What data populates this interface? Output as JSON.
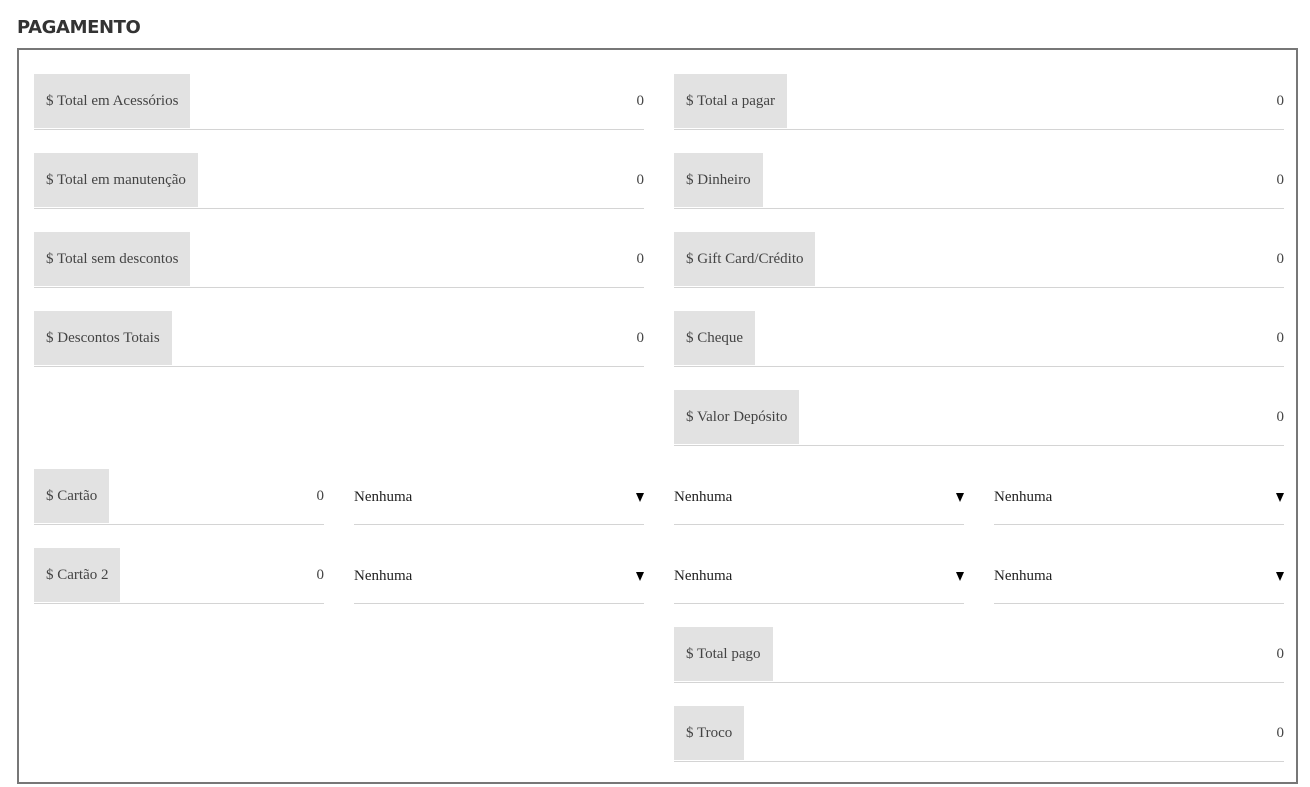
{
  "section": {
    "title": "PAGAMENTO"
  },
  "left_fields": [
    {
      "label": "$ Total em Acessórios",
      "value": "0"
    },
    {
      "label": "$ Total em manutenção",
      "value": "0"
    },
    {
      "label": "$ Total sem descontos",
      "value": "0"
    },
    {
      "label": "$ Descontos Totais",
      "value": "0"
    }
  ],
  "right_fields": [
    {
      "label": "$ Total a pagar",
      "value": "0"
    },
    {
      "label": "$ Dinheiro",
      "value": "0"
    },
    {
      "label": "$ Gift Card/Crédito",
      "value": "0"
    },
    {
      "label": "$ Cheque",
      "value": "0"
    },
    {
      "label": "$ Valor Depósito",
      "value": "0"
    }
  ],
  "cards": [
    {
      "label": "$ Cartão",
      "value": "0",
      "selects": [
        "Nenhuma",
        "Nenhuma",
        "Nenhuma"
      ]
    },
    {
      "label": "$ Cartão 2",
      "value": "0",
      "selects": [
        "Nenhuma",
        "Nenhuma",
        "Nenhuma"
      ]
    }
  ],
  "totals": [
    {
      "label": "$ Total pago",
      "value": "0"
    },
    {
      "label": "$ Troco",
      "value": "0"
    }
  ]
}
